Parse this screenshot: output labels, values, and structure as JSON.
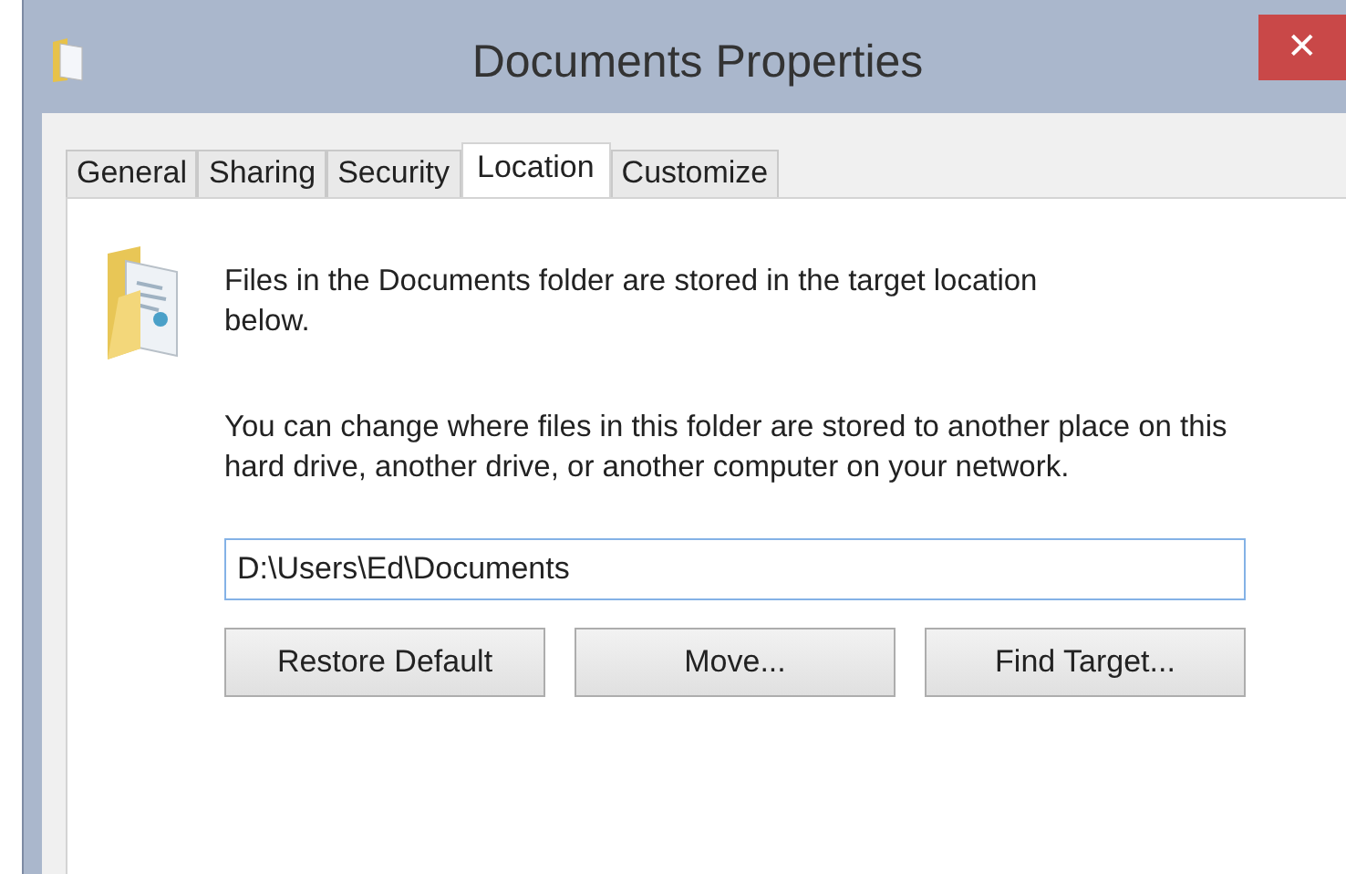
{
  "window": {
    "title": "Documents Properties",
    "close": "✕"
  },
  "tabs": [
    {
      "label": "General",
      "selected": false
    },
    {
      "label": "Sharing",
      "selected": false
    },
    {
      "label": "Security",
      "selected": false
    },
    {
      "label": "Location",
      "selected": true
    },
    {
      "label": "Customize",
      "selected": false
    }
  ],
  "info_text": "Files in the Documents folder are stored in the target location below.",
  "description": "You can change where files in this folder are stored to another place on this hard drive, another drive, or another computer on your network.",
  "path_field": {
    "value": "D:\\Users\\Ed\\Documents",
    "focused": true
  },
  "buttons": [
    "Restore Default",
    "Move...",
    "Find Target..."
  ]
}
